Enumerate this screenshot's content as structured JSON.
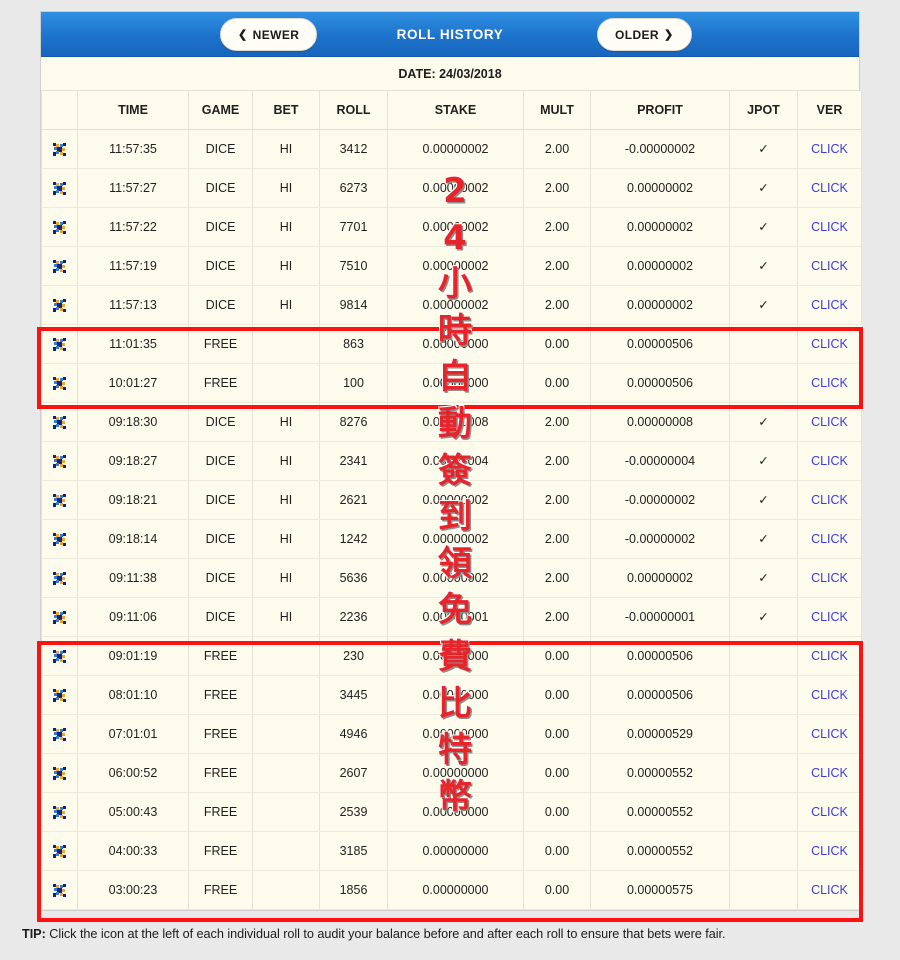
{
  "header": {
    "title": "ROLL HISTORY",
    "newer_label": "NEWER",
    "older_label": "OLDER",
    "newer_chevron": "❮",
    "older_chevron": "❯"
  },
  "date_strip": "DATE: 24/03/2018",
  "columns": [
    "TIME",
    "GAME",
    "BET",
    "ROLL",
    "STAKE",
    "MULT",
    "PROFIT",
    "JPOT",
    "VER"
  ],
  "icons": {
    "row_audit": "scatter-x-icon",
    "verified_tick": "✓"
  },
  "click_label": "CLICK",
  "colors": {
    "header_blue": "#1d73cc",
    "profit_positive": "#16713c",
    "profit_negative": "#e23a2e",
    "click_link": "#3a3ae8",
    "annotation_red": "#ff1111",
    "table_bg": "#fdfbec"
  },
  "watermark_chars": [
    "2",
    "4",
    "小",
    "時",
    "自",
    "動",
    "簽",
    "到",
    "領",
    "免",
    "費",
    "比",
    "特",
    "幣"
  ],
  "rows": [
    {
      "time": "11:57:35",
      "game": "DICE",
      "bet": "HI",
      "roll": "3412",
      "stake": "0.00000002",
      "mult": "2.00",
      "profit": "-0.00000002",
      "profit_sign": "neg",
      "jpot": "✓",
      "ver": "CLICK"
    },
    {
      "time": "11:57:27",
      "game": "DICE",
      "bet": "HI",
      "roll": "6273",
      "stake": "0.00000002",
      "mult": "2.00",
      "profit": "0.00000002",
      "profit_sign": "pos",
      "jpot": "✓",
      "ver": "CLICK"
    },
    {
      "time": "11:57:22",
      "game": "DICE",
      "bet": "HI",
      "roll": "7701",
      "stake": "0.00000002",
      "mult": "2.00",
      "profit": "0.00000002",
      "profit_sign": "pos",
      "jpot": "✓",
      "ver": "CLICK"
    },
    {
      "time": "11:57:19",
      "game": "DICE",
      "bet": "HI",
      "roll": "7510",
      "stake": "0.00000002",
      "mult": "2.00",
      "profit": "0.00000002",
      "profit_sign": "pos",
      "jpot": "✓",
      "ver": "CLICK"
    },
    {
      "time": "11:57:13",
      "game": "DICE",
      "bet": "HI",
      "roll": "9814",
      "stake": "0.00000002",
      "mult": "2.00",
      "profit": "0.00000002",
      "profit_sign": "pos",
      "jpot": "✓",
      "ver": "CLICK"
    },
    {
      "time": "11:01:35",
      "game": "FREE",
      "bet": "",
      "roll": "863",
      "stake": "0.00000000",
      "mult": "0.00",
      "profit": "0.00000506",
      "profit_sign": "pos",
      "jpot": "",
      "ver": "CLICK"
    },
    {
      "time": "10:01:27",
      "game": "FREE",
      "bet": "",
      "roll": "100",
      "stake": "0.00000000",
      "mult": "0.00",
      "profit": "0.00000506",
      "profit_sign": "pos",
      "jpot": "",
      "ver": "CLICK"
    },
    {
      "time": "09:18:30",
      "game": "DICE",
      "bet": "HI",
      "roll": "8276",
      "stake": "0.00000008",
      "mult": "2.00",
      "profit": "0.00000008",
      "profit_sign": "pos",
      "jpot": "✓",
      "ver": "CLICK"
    },
    {
      "time": "09:18:27",
      "game": "DICE",
      "bet": "HI",
      "roll": "2341",
      "stake": "0.00000004",
      "mult": "2.00",
      "profit": "-0.00000004",
      "profit_sign": "neg",
      "jpot": "✓",
      "ver": "CLICK"
    },
    {
      "time": "09:18:21",
      "game": "DICE",
      "bet": "HI",
      "roll": "2621",
      "stake": "0.00000002",
      "mult": "2.00",
      "profit": "-0.00000002",
      "profit_sign": "neg",
      "jpot": "✓",
      "ver": "CLICK"
    },
    {
      "time": "09:18:14",
      "game": "DICE",
      "bet": "HI",
      "roll": "1242",
      "stake": "0.00000002",
      "mult": "2.00",
      "profit": "-0.00000002",
      "profit_sign": "neg",
      "jpot": "✓",
      "ver": "CLICK"
    },
    {
      "time": "09:11:38",
      "game": "DICE",
      "bet": "HI",
      "roll": "5636",
      "stake": "0.00000002",
      "mult": "2.00",
      "profit": "0.00000002",
      "profit_sign": "pos",
      "jpot": "✓",
      "ver": "CLICK"
    },
    {
      "time": "09:11:06",
      "game": "DICE",
      "bet": "HI",
      "roll": "2236",
      "stake": "0.00000001",
      "mult": "2.00",
      "profit": "-0.00000001",
      "profit_sign": "neg",
      "jpot": "✓",
      "ver": "CLICK"
    },
    {
      "time": "09:01:19",
      "game": "FREE",
      "bet": "",
      "roll": "230",
      "stake": "0.00000000",
      "mult": "0.00",
      "profit": "0.00000506",
      "profit_sign": "pos",
      "jpot": "",
      "ver": "CLICK"
    },
    {
      "time": "08:01:10",
      "game": "FREE",
      "bet": "",
      "roll": "3445",
      "stake": "0.00000000",
      "mult": "0.00",
      "profit": "0.00000506",
      "profit_sign": "pos",
      "jpot": "",
      "ver": "CLICK"
    },
    {
      "time": "07:01:01",
      "game": "FREE",
      "bet": "",
      "roll": "4946",
      "stake": "0.00000000",
      "mult": "0.00",
      "profit": "0.00000529",
      "profit_sign": "pos",
      "jpot": "",
      "ver": "CLICK"
    },
    {
      "time": "06:00:52",
      "game": "FREE",
      "bet": "",
      "roll": "2607",
      "stake": "0.00000000",
      "mult": "0.00",
      "profit": "0.00000552",
      "profit_sign": "pos",
      "jpot": "",
      "ver": "CLICK"
    },
    {
      "time": "05:00:43",
      "game": "FREE",
      "bet": "",
      "roll": "2539",
      "stake": "0.00000000",
      "mult": "0.00",
      "profit": "0.00000552",
      "profit_sign": "pos",
      "jpot": "",
      "ver": "CLICK"
    },
    {
      "time": "04:00:33",
      "game": "FREE",
      "bet": "",
      "roll": "3185",
      "stake": "0.00000000",
      "mult": "0.00",
      "profit": "0.00000552",
      "profit_sign": "pos",
      "jpot": "",
      "ver": "CLICK"
    },
    {
      "time": "03:00:23",
      "game": "FREE",
      "bet": "",
      "roll": "1856",
      "stake": "0.00000000",
      "mult": "0.00",
      "profit": "0.00000575",
      "profit_sign": "pos",
      "jpot": "",
      "ver": "CLICK"
    }
  ],
  "tip": {
    "label": "TIP:",
    "text": " Click the icon at the left of each individual roll to audit your balance before and after each roll to ensure that bets were fair."
  }
}
